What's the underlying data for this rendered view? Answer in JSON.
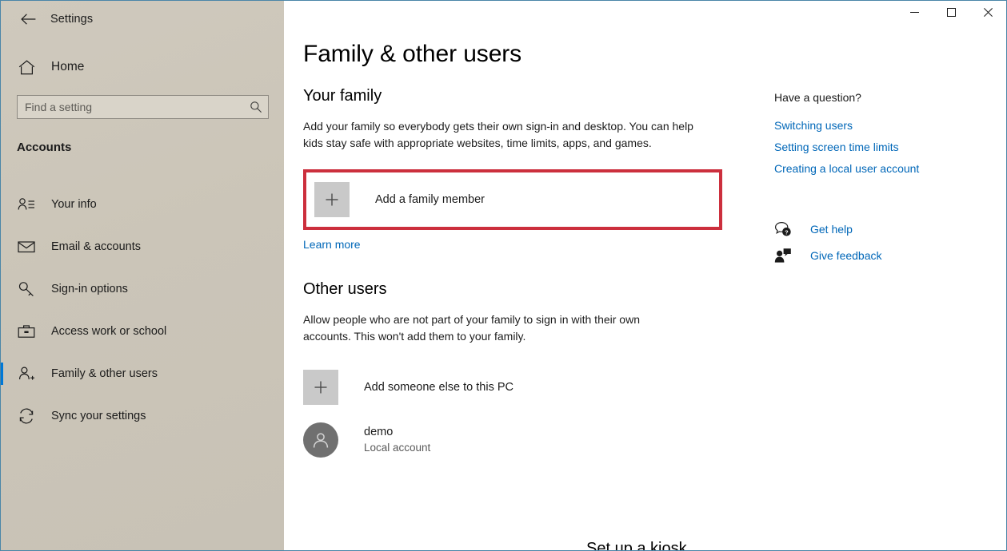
{
  "window": {
    "app_title": "Settings",
    "back_icon": "back-arrow-icon",
    "controls": {
      "minimize": "minimize-icon",
      "maximize": "maximize-icon",
      "close": "close-icon"
    },
    "accent_color": "#0078d7",
    "border_color": "#4a86a8"
  },
  "sidebar": {
    "home_label": "Home",
    "home_icon": "home-icon",
    "search": {
      "placeholder": "Find a setting",
      "value": "",
      "icon": "search-icon"
    },
    "category": "Accounts",
    "items": [
      {
        "label": "Your info",
        "icon": "person-info-icon",
        "selected": false
      },
      {
        "label": "Email & accounts",
        "icon": "envelope-icon",
        "selected": false
      },
      {
        "label": "Sign-in options",
        "icon": "key-icon",
        "selected": false
      },
      {
        "label": "Access work or school",
        "icon": "briefcase-icon",
        "selected": false
      },
      {
        "label": "Family & other users",
        "icon": "person-add-icon",
        "selected": true
      },
      {
        "label": "Sync your settings",
        "icon": "sync-icon",
        "selected": false
      }
    ]
  },
  "main": {
    "page_title": "Family & other users",
    "your_family": {
      "heading": "Your family",
      "description": "Add your family so everybody gets their own sign-in and desktop. You can help kids stay safe with appropriate websites, time limits, apps, and games.",
      "add_button_label": "Add a family member",
      "add_button_icon": "plus-icon",
      "learn_more_label": "Learn more",
      "highlight_color": "#cc2f3d"
    },
    "other_users": {
      "heading": "Other users",
      "description": "Allow people who are not part of your family to sign in with their own accounts. This won't add them to your family.",
      "add_button_label": "Add someone else to this PC",
      "add_button_icon": "plus-icon",
      "accounts": [
        {
          "name": "demo",
          "type": "Local account",
          "avatar_icon": "person-avatar-icon"
        }
      ]
    },
    "clipped_heading": "Set up a kiosk"
  },
  "right_panel": {
    "title": "Have a question?",
    "links": [
      "Switching users",
      "Setting screen time limits",
      "Creating a local user account"
    ],
    "help_items": [
      {
        "label": "Get help",
        "icon": "get-help-icon"
      },
      {
        "label": "Give feedback",
        "icon": "give-feedback-icon"
      }
    ],
    "link_color": "#0067b8"
  }
}
